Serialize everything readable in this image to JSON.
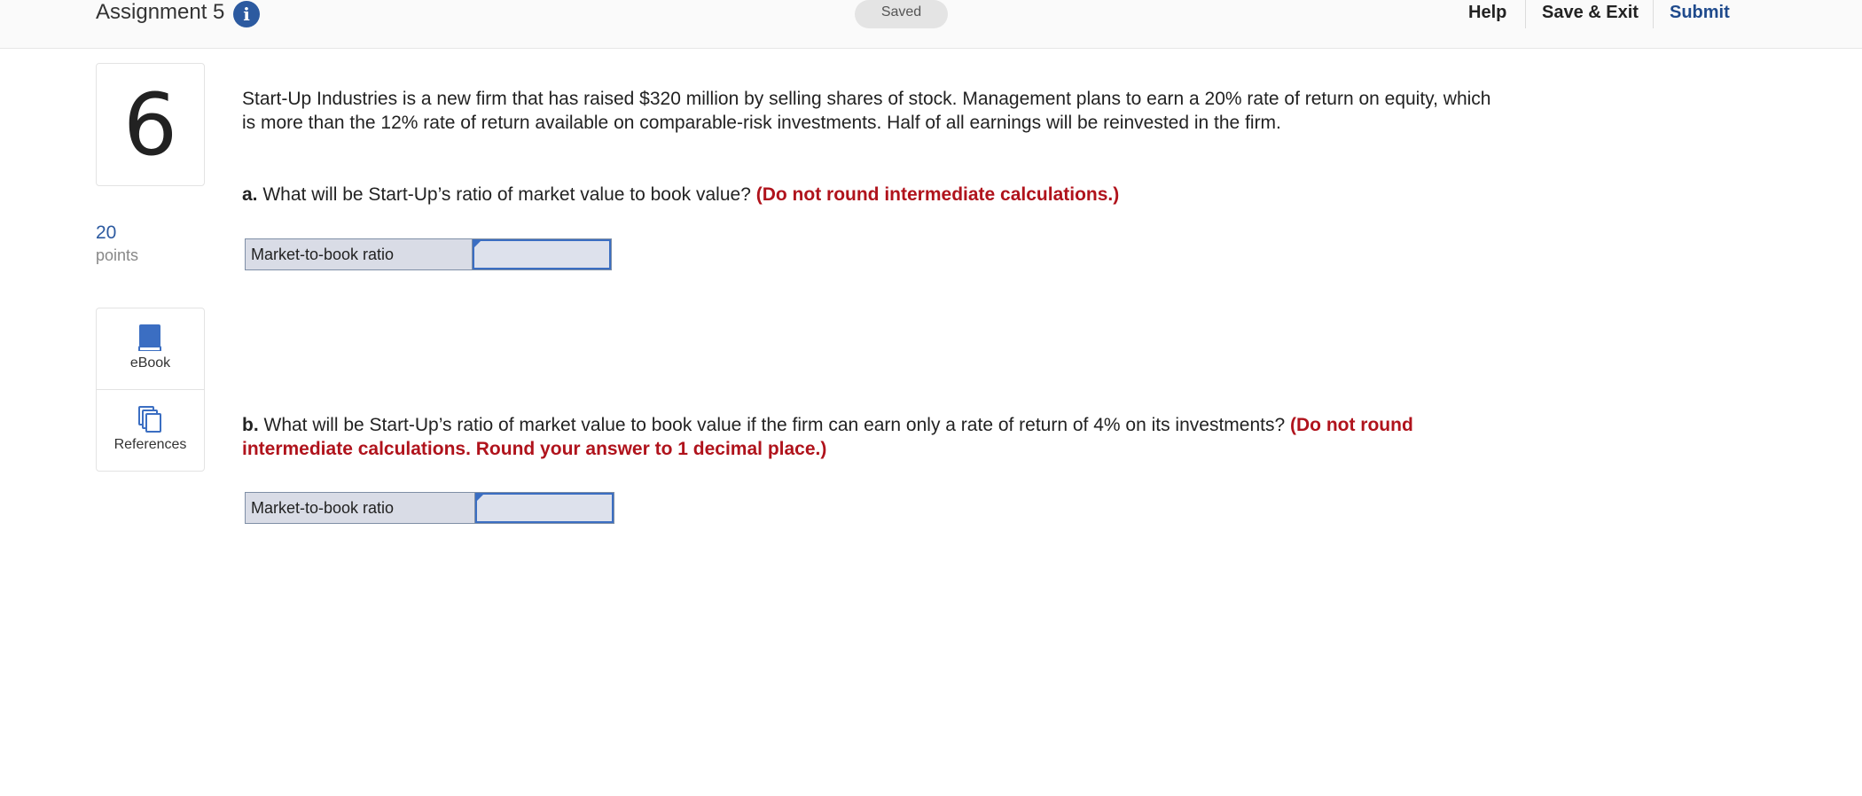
{
  "header": {
    "assignment_title": "Assignment 5",
    "info_icon": "info-icon",
    "status": "Saved",
    "nav": {
      "help": "Help",
      "save_exit": "Save & Exit",
      "submit": "Submit"
    },
    "submit_color": "#1f4a8c"
  },
  "question": {
    "number": "6",
    "points_value": "20",
    "points_label": "points",
    "tools": [
      {
        "label": "eBook",
        "icon": "book-icon"
      },
      {
        "label": "References",
        "icon": "copy-icon"
      }
    ],
    "text": "Start-Up Industries is a new firm that has raised $320 million by selling shares of stock. Management plans to earn a 20% rate of return on equity, which is more than the 12% rate of return available on comparable-risk investments. Half of all earnings will be reinvested in the firm.",
    "part_a": {
      "prefix": "a.",
      "text": " What will be Start-Up’s ratio of market value to book value? ",
      "instruction": "(Do not round intermediate calculations.)",
      "answer_label": "Market-to-book ratio",
      "answer_value": ""
    },
    "part_b": {
      "prefix": "b.",
      "text": " What will be Start-Up’s ratio of market value to book value if the firm can earn only a rate of return of 4% on its investments? ",
      "instruction": "(Do not round intermediate calculations. Round your answer to 1 decimal place.)",
      "answer_label": "Market-to-book ratio",
      "answer_value": ""
    }
  },
  "colors": {
    "accent_blue": "#2c5aa0",
    "instruction_red": "#b0131c",
    "input_border": "#3b6ec2"
  }
}
